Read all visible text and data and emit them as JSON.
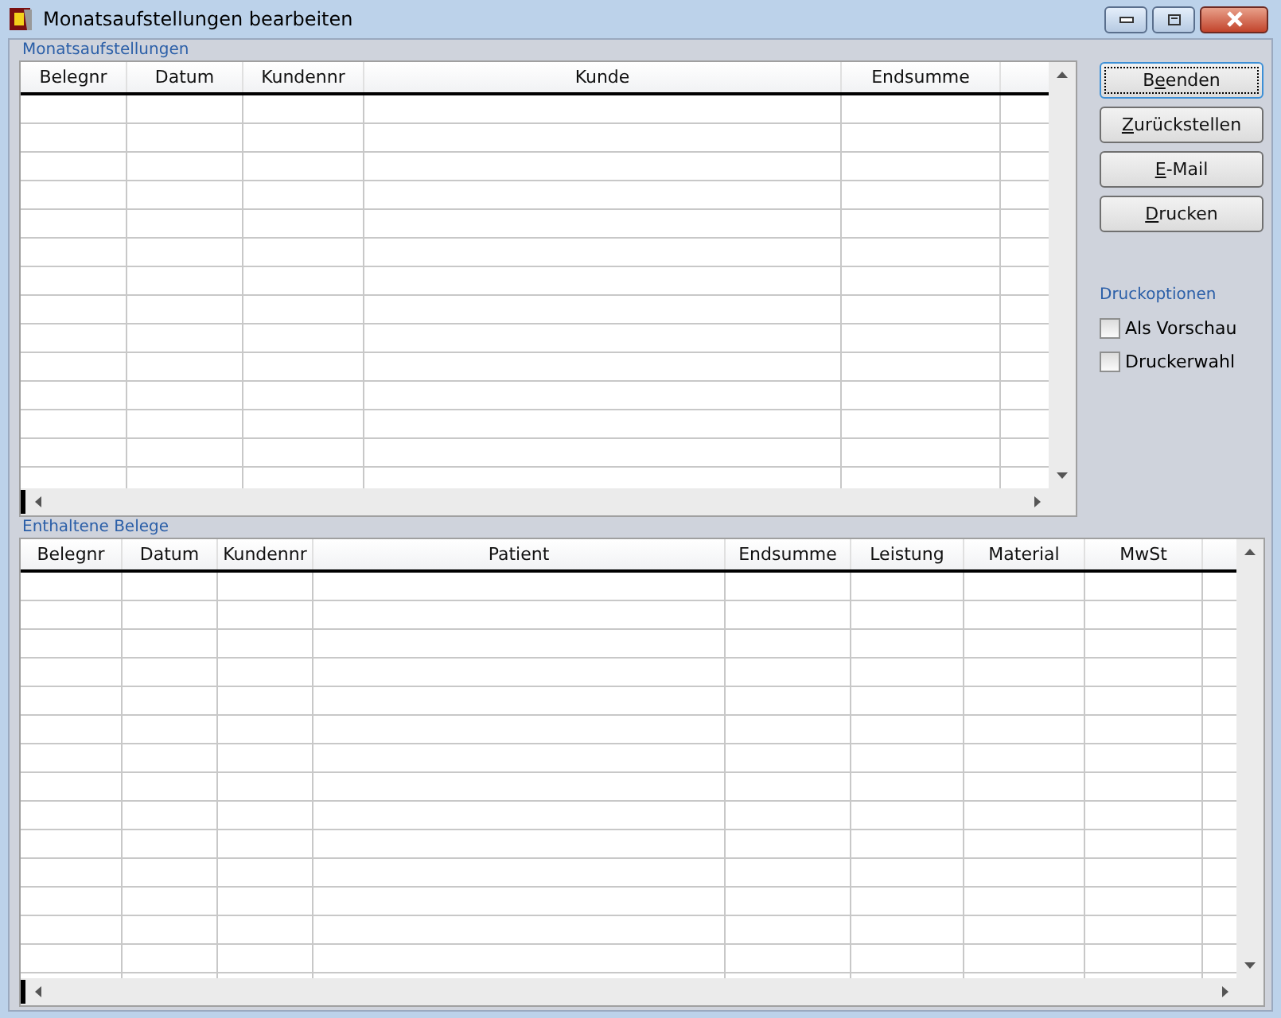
{
  "window": {
    "title": "Monatsaufstellungen bearbeiten"
  },
  "monthly_statements": {
    "label": "Monatsaufstellungen",
    "columns": [
      "Belegnr",
      "Datum",
      "Kundennr",
      "Kunde",
      "Endsumme"
    ]
  },
  "buttons": [
    {
      "pre": "B",
      "key": "e",
      "post": "enden",
      "focused": true
    },
    {
      "key": "Z",
      "post": "urückstellen",
      "focused": false
    },
    {
      "key": "E",
      "post": "-Mail",
      "focused": false
    },
    {
      "key": "D",
      "post": "rucken",
      "focused": false
    }
  ],
  "print_options": {
    "label": "Druckoptionen",
    "options": [
      {
        "label": "Als Vorschau",
        "checked": false
      },
      {
        "label": "Druckerwahl",
        "checked": false
      }
    ]
  },
  "contained_documents": {
    "label": "Enthaltene Belege",
    "columns": [
      "Belegnr",
      "Datum",
      "Kundennr",
      "Patient",
      "Endsumme",
      "Leistung",
      "Material",
      "MwSt"
    ]
  }
}
